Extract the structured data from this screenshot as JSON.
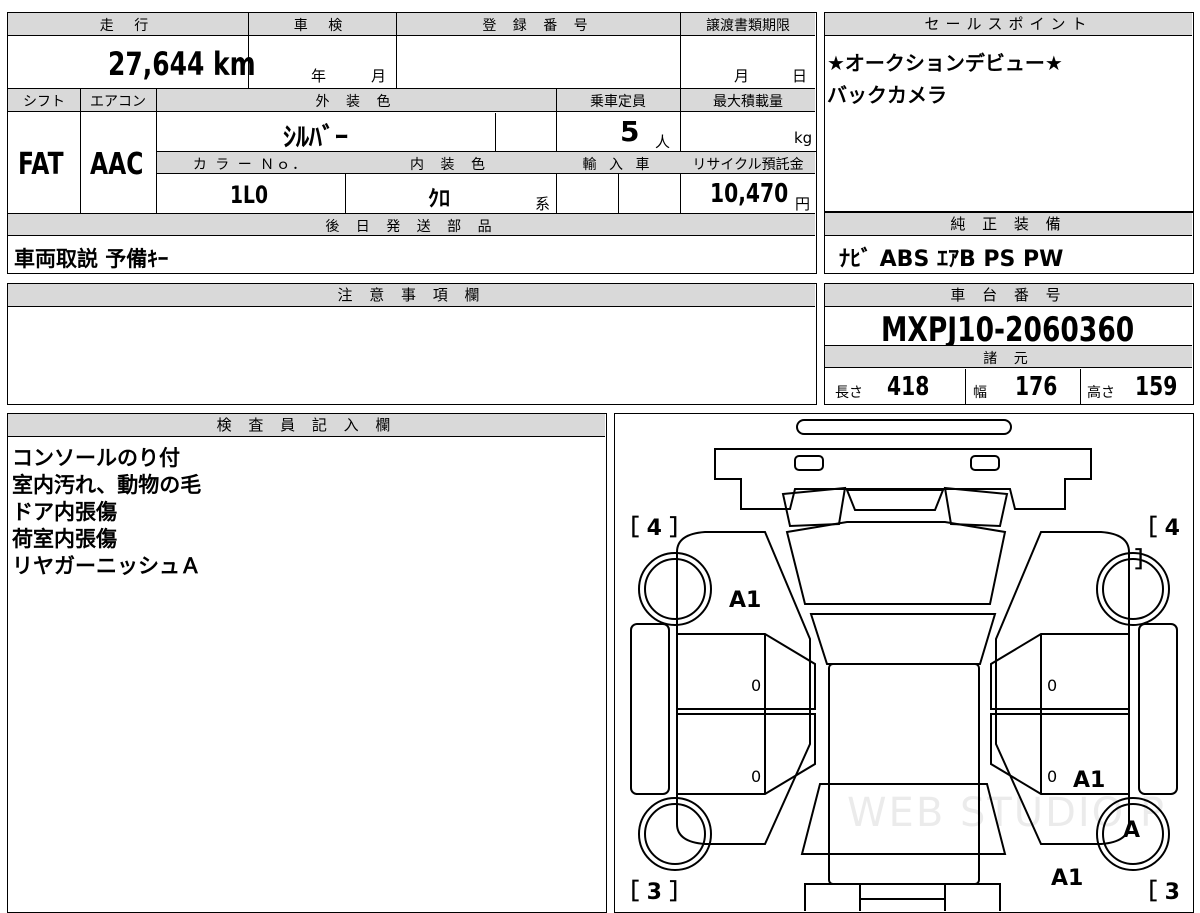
{
  "top_info": {
    "mileage_label": "走 行",
    "mileage_value": "27,644",
    "mileage_unit": "km",
    "inspection_label": "車 検",
    "inspection_year": "年",
    "inspection_month": "月",
    "registration_label": "登 録 番 号",
    "transfer_label": "譲渡書類期限",
    "transfer_month": "月",
    "transfer_day": "日"
  },
  "specs": {
    "shift_label": "シフト",
    "shift_value": "FAT",
    "aircon_label": "エアコン",
    "aircon_value": "AAC",
    "exterior_label": "外 装 色",
    "exterior_value": "ｼﾙﾊﾞｰ",
    "capacity_label": "乗車定員",
    "capacity_value": "5",
    "capacity_unit": "人",
    "maxload_label": "最大積載量",
    "maxload_unit": "kg",
    "colorno_label": "カ ラ ー Ｎｏ．",
    "colorno_value": "1L0",
    "interior_label": "内 装 色",
    "interior_value": "ｸﾛ",
    "interior_suffix": "系",
    "import_label": "輸 入 車",
    "recycle_label": "リサイクル預託金",
    "recycle_value": "10,470",
    "recycle_unit": "円"
  },
  "later_parts": {
    "label": "後 日 発 送 部 品",
    "value": "車両取説 予備ｷｰ"
  },
  "notes": {
    "label": "注 意 事 項 欄"
  },
  "sales_points": {
    "label": "セールスポイント",
    "lines": [
      "★オークションデビュー★",
      "バックカメラ"
    ]
  },
  "equipment": {
    "label": "純 正 装 備",
    "value": "ﾅﾋﾞ ABS ｴｱB PS PW"
  },
  "chassis": {
    "label": "車 台 番 号",
    "value": "MXPJ10-2060360"
  },
  "dimensions": {
    "label": "諸 元",
    "length_label": "長さ",
    "length_value": "418",
    "width_label": "幅",
    "width_value": "176",
    "height_label": "高さ",
    "height_value": "159"
  },
  "inspector": {
    "label": "検 査 員 記 入 欄",
    "lines": [
      "コンソールのり付",
      "室内汚れ、動物の毛",
      "ドア内張傷",
      "荷室内張傷",
      "リヤガーニッシュＡ"
    ]
  },
  "diagram": {
    "tire_fl": "［ 4 ］",
    "tire_fr": "［ 4 ］",
    "tire_rl": "［ 3 ］",
    "tire_rr": "［ 3 ］",
    "mark_a1_front_left": "A1",
    "mark_a1_right": "A1",
    "mark_a1_rear": "A1",
    "mark_a_wheel": "A",
    "door_left_front": "0",
    "door_left_rear": "0",
    "door_right_front": "0",
    "door_right_rear": "0",
    "watermark": "WEB STUDIO P"
  }
}
